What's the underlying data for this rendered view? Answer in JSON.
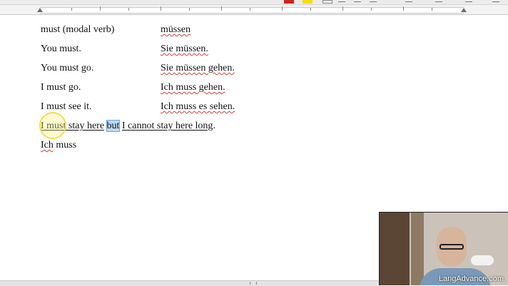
{
  "document": {
    "rows": [
      {
        "english": "must (modal verb)",
        "german": "müssen"
      },
      {
        "english": "You must.",
        "german": "Sie müssen."
      },
      {
        "english": "You must go.",
        "german": "Sie müssen gehen."
      },
      {
        "english": "I must go.",
        "german": "Ich muss gehen."
      },
      {
        "english": "I must see it.",
        "german": "Ich muss es sehen."
      }
    ],
    "sentence": {
      "part1": "I must stay here",
      "highlight": "but",
      "part2": "I cannot stay here long",
      "end": "."
    },
    "last_line": {
      "word1": "Ich",
      "word2": " muss"
    }
  },
  "webcam": {
    "watermark": "LangAdvance.com"
  },
  "colors": {
    "spell_error": "#d04040",
    "selection": "#bcd8f0",
    "cursor_highlight": "#fff378"
  }
}
